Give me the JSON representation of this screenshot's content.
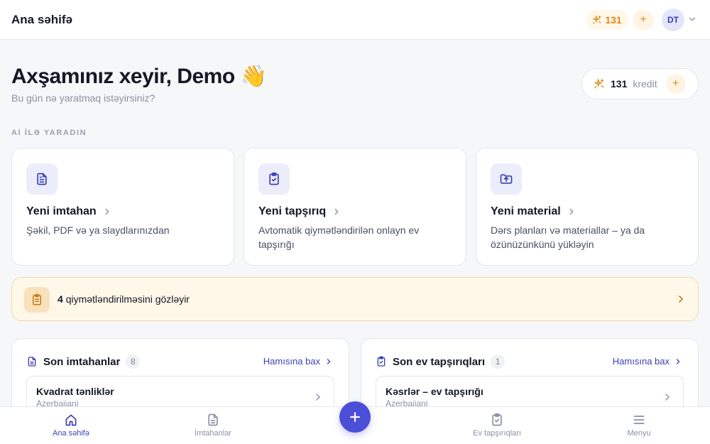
{
  "topbar": {
    "title": "Ana səhifə",
    "credits": "131",
    "avatar_initials": "DT"
  },
  "hero": {
    "greeting": "Axşamınız xeyir, Demo",
    "greeting_emoji": "👋",
    "subtitle": "Bu gün nə yaratmaq istəyirsiniz?",
    "credit_value": "131",
    "credit_label": "kredit"
  },
  "section_label": "AI İLƏ YARADIN",
  "cards": [
    {
      "title": "Yeni imtahan",
      "desc": "Şəkil, PDF və ya slaydlarınızdan",
      "icon": "document-icon"
    },
    {
      "title": "Yeni tapşırıq",
      "desc": "Avtomatik qiymətləndirilən onlayn ev tapşırığı",
      "icon": "clipboard-check-icon"
    },
    {
      "title": "Yeni material",
      "desc": "Dərs planları və materiallar – ya da özünüzünkünü yükləyin",
      "icon": "folder-upload-icon"
    }
  ],
  "pending": {
    "count": "4",
    "text": "qiymətləndirilməsini gözləyir"
  },
  "panels": [
    {
      "title": "Son imtahanlar",
      "count": "8",
      "see_all": "Hamısına bax",
      "item_title": "Kvadrat tənliklər",
      "item_sub": "Azerbaijani"
    },
    {
      "title": "Son ev tapşırıqları",
      "count": "1",
      "see_all": "Hamısına bax",
      "item_title": "Kəsrlər – ev tapşırığı",
      "item_sub": "Azerbaijani"
    }
  ],
  "bottom_nav": {
    "home": "Ana səhifə",
    "exams": "İmtahanlar",
    "homework": "Ev tapşırıqları",
    "menu": "Menyu"
  },
  "colors": {
    "accent": "#4b4fd8",
    "credit": "#e08a1e",
    "pending_bg": "#fff8e9"
  }
}
